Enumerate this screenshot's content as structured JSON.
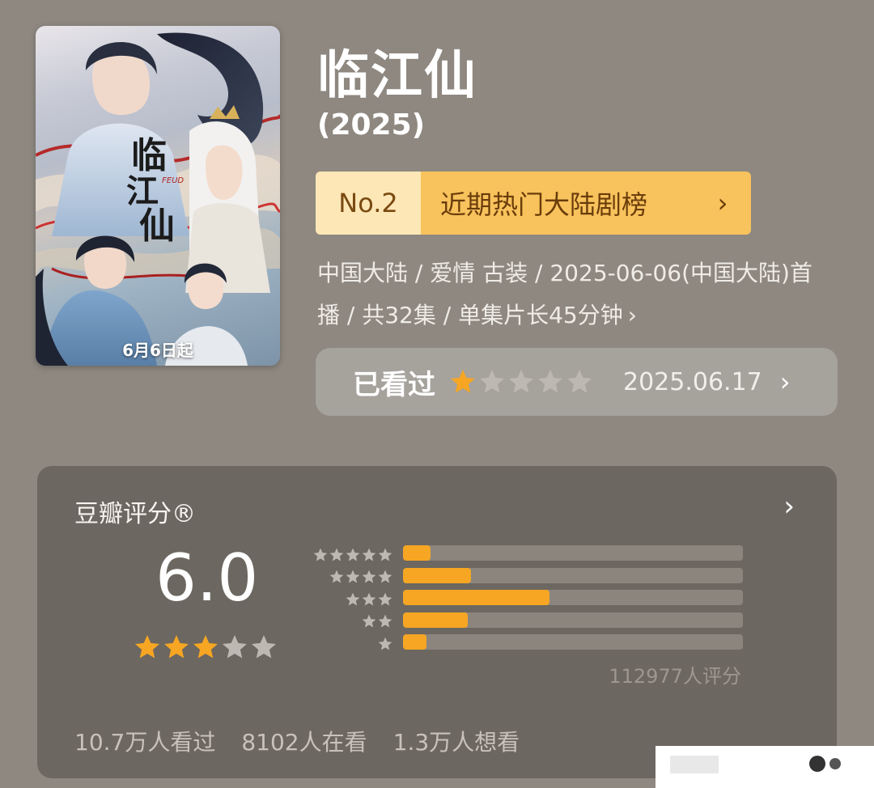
{
  "poster": {
    "caption": "6月6日起"
  },
  "title": "临江仙",
  "year": "(2025)",
  "ranking": {
    "number": "No.2",
    "label": "近期热门大陆剧榜",
    "chevron": "›"
  },
  "meta": {
    "line": "中国大陆 / 爱情 古装 / 2025-06-06(中国大陆)首播 / 共32集 / 单集片长45分钟",
    "chevron": "›"
  },
  "my_rating": {
    "label": "已看过",
    "stars": 1,
    "date": "2025.06.17",
    "chevron": "›"
  },
  "rating_card": {
    "title": "豆瓣评分®",
    "chevron": "›",
    "score": "6.0",
    "score_stars": 3,
    "histogram": [
      {
        "stars": 5,
        "fraction": 0.08
      },
      {
        "stars": 4,
        "fraction": 0.2
      },
      {
        "stars": 3,
        "fraction": 0.43
      },
      {
        "stars": 2,
        "fraction": 0.19
      },
      {
        "stars": 1,
        "fraction": 0.07
      }
    ],
    "vote_count": "112977人评分",
    "stats": [
      "10.7万人看过",
      "8102人在看",
      "1.3万人想看"
    ]
  },
  "colors": {
    "background": "#8e8880",
    "card": "#6c6760",
    "star_active": "#f6a623",
    "star_inactive": "#bdb8b2",
    "rank_bar": "#f8c25c",
    "rank_no_bg": "#fde7b6"
  }
}
